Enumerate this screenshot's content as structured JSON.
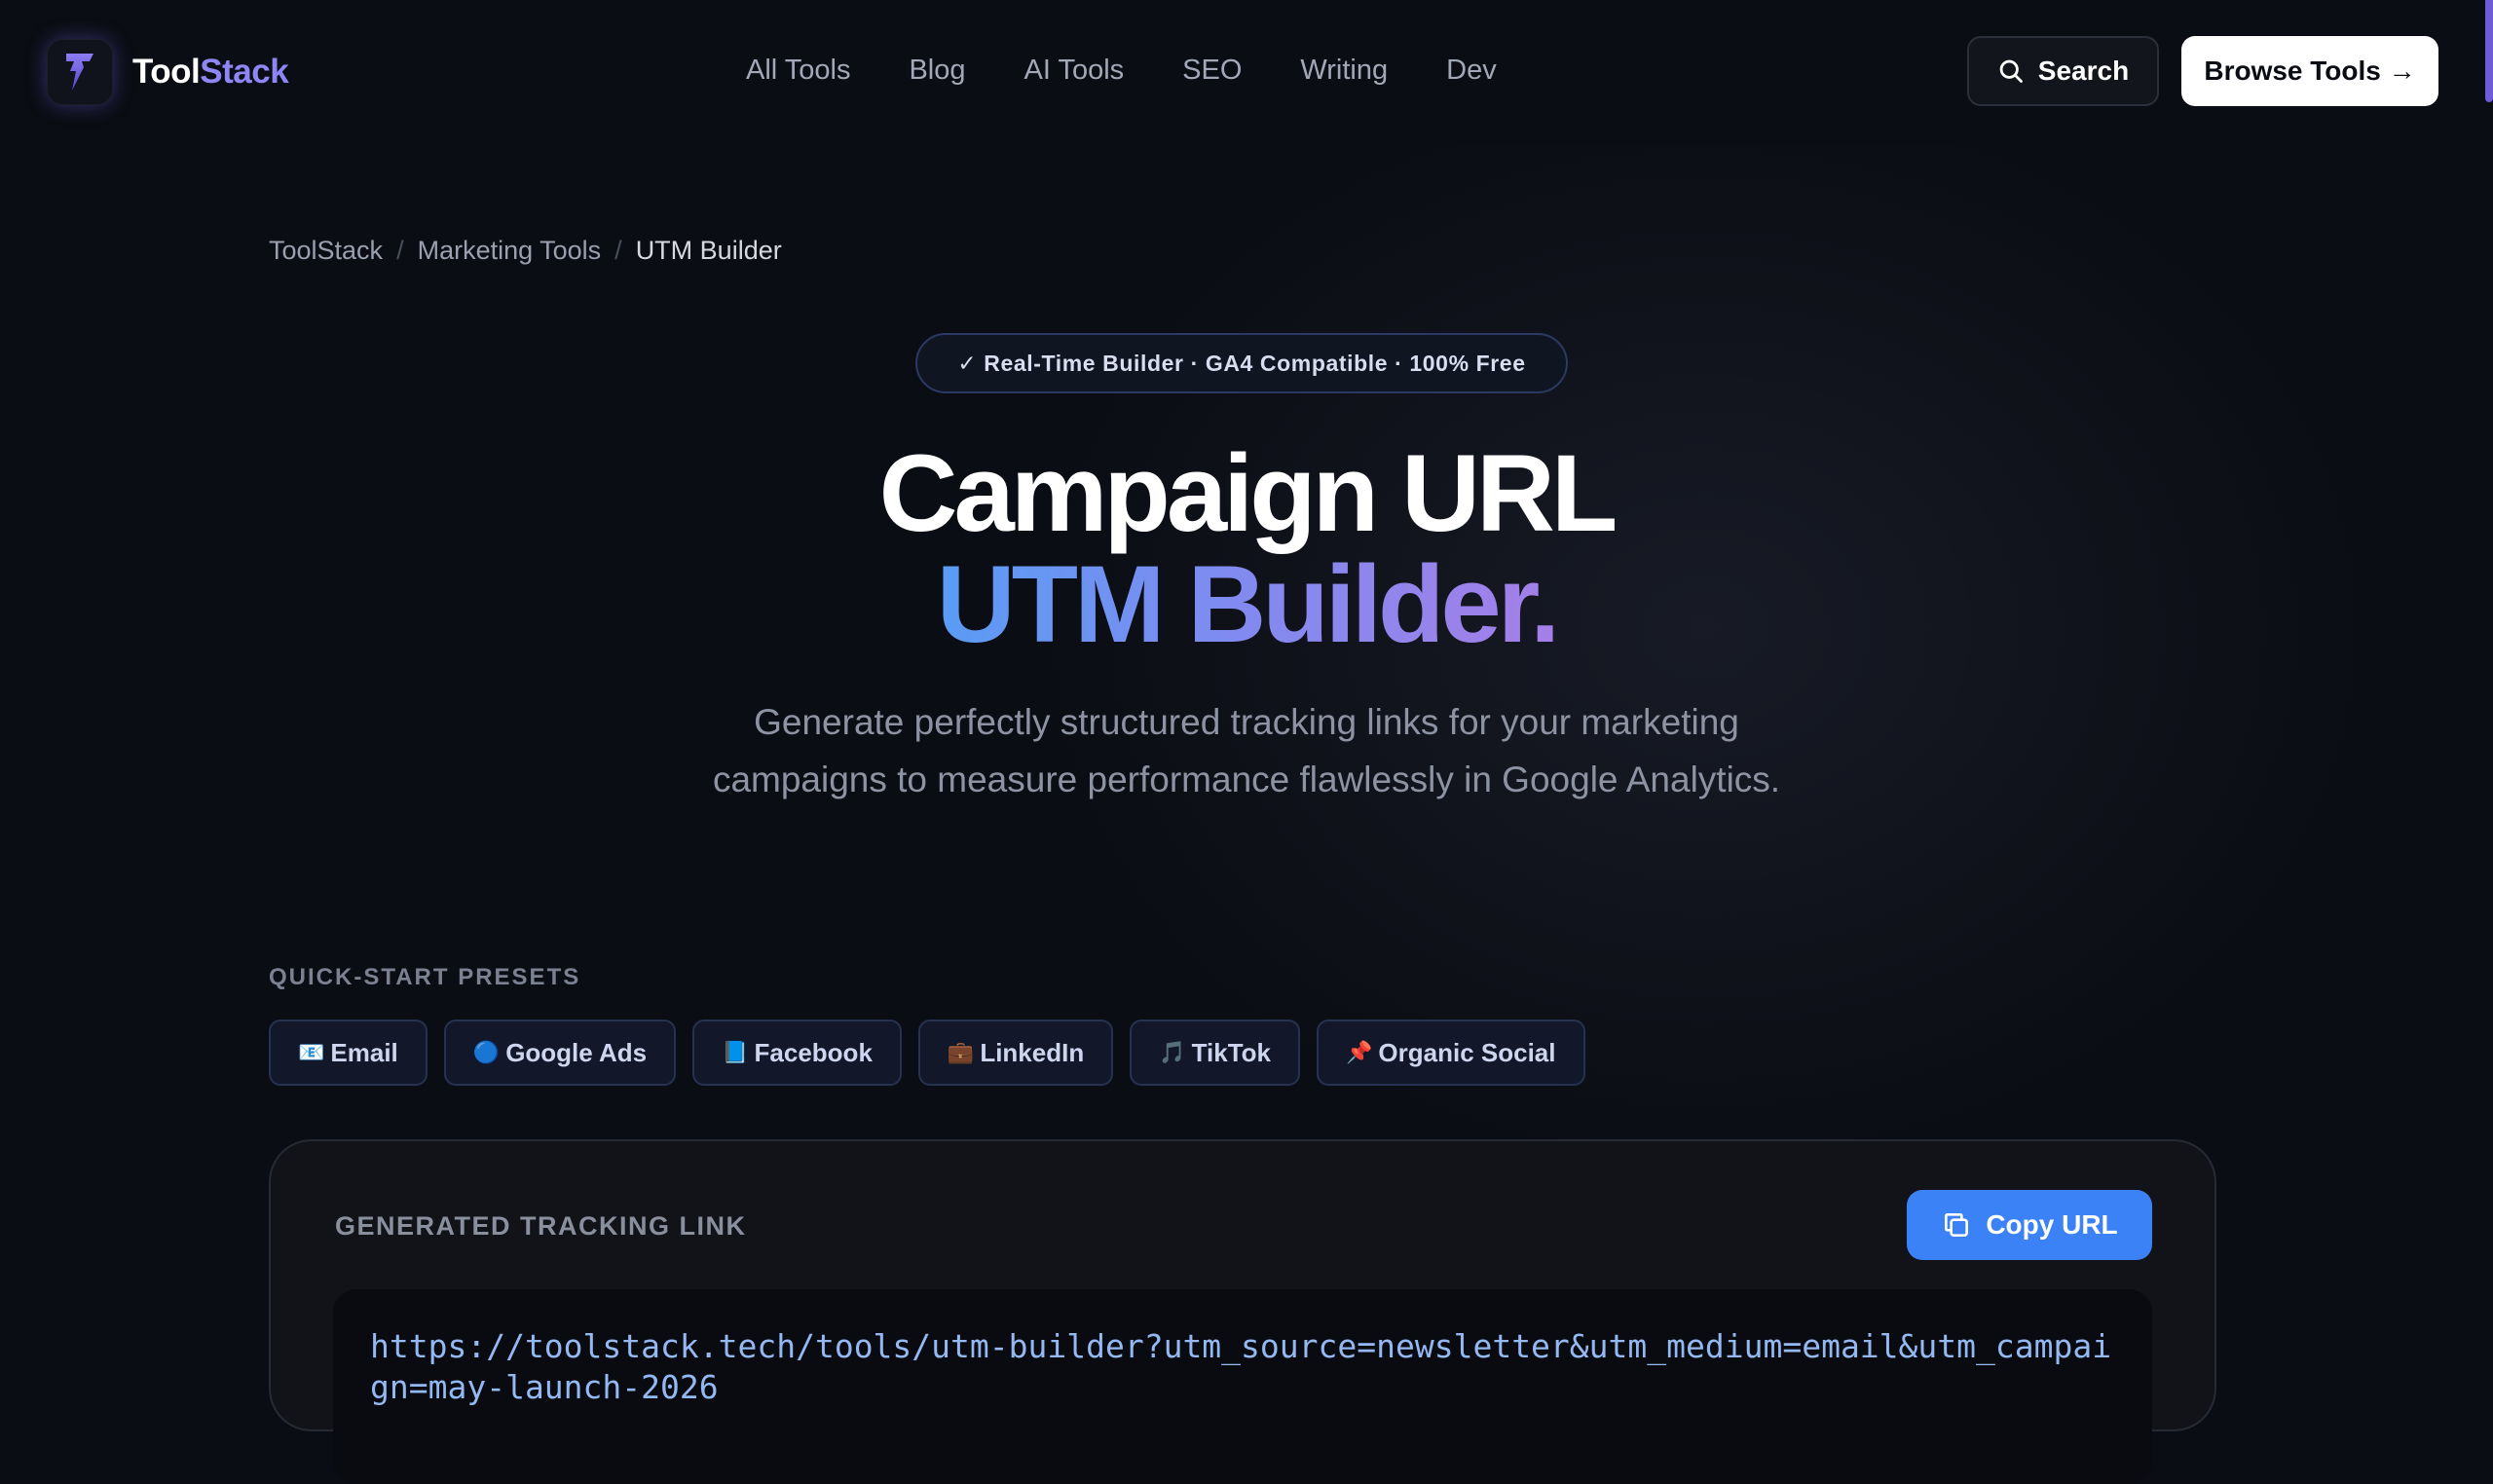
{
  "brand": {
    "name_part1": "Tool",
    "name_part2": "Stack",
    "accent": "#6d5bd8",
    "logo_icon": "lightning-bolt-icon"
  },
  "nav": {
    "items": [
      "All Tools",
      "Blog",
      "AI Tools",
      "SEO",
      "Writing",
      "Dev"
    ]
  },
  "header": {
    "search_label": "Search",
    "browse_label": "Browse Tools →"
  },
  "breadcrumb": {
    "items": [
      "ToolStack",
      "Marketing Tools",
      "UTM Builder"
    ],
    "separator": "/"
  },
  "badge": {
    "text": "✓ Real-Time Builder · GA4 Compatible · 100% Free"
  },
  "hero": {
    "title_line1": "Campaign URL",
    "title_line2": "UTM Builder.",
    "subtitle": "Generate perfectly structured tracking links for your marketing campaigns to measure performance flawlessly in Google Analytics."
  },
  "presets": {
    "label": "QUICK-START PRESETS",
    "items": [
      {
        "icon": "📧",
        "label": "Email"
      },
      {
        "icon": "🔵",
        "label": "Google Ads"
      },
      {
        "icon": "📘",
        "label": "Facebook"
      },
      {
        "icon": "💼",
        "label": "LinkedIn"
      },
      {
        "icon": "🎵",
        "label": "TikTok"
      },
      {
        "icon": "📌",
        "label": "Organic Social"
      }
    ]
  },
  "output": {
    "label": "GENERATED TRACKING LINK",
    "copy_label": "Copy URL",
    "url": "https://toolstack.tech/tools/utm-builder?utm_source=newsletter&utm_medium=email&utm_campaign=may-launch-2026"
  },
  "colors": {
    "primary": "#3b82f6",
    "gradient_start": "#5a9cf5",
    "gradient_end": "#a47fe8",
    "background": "#0b0d14"
  }
}
